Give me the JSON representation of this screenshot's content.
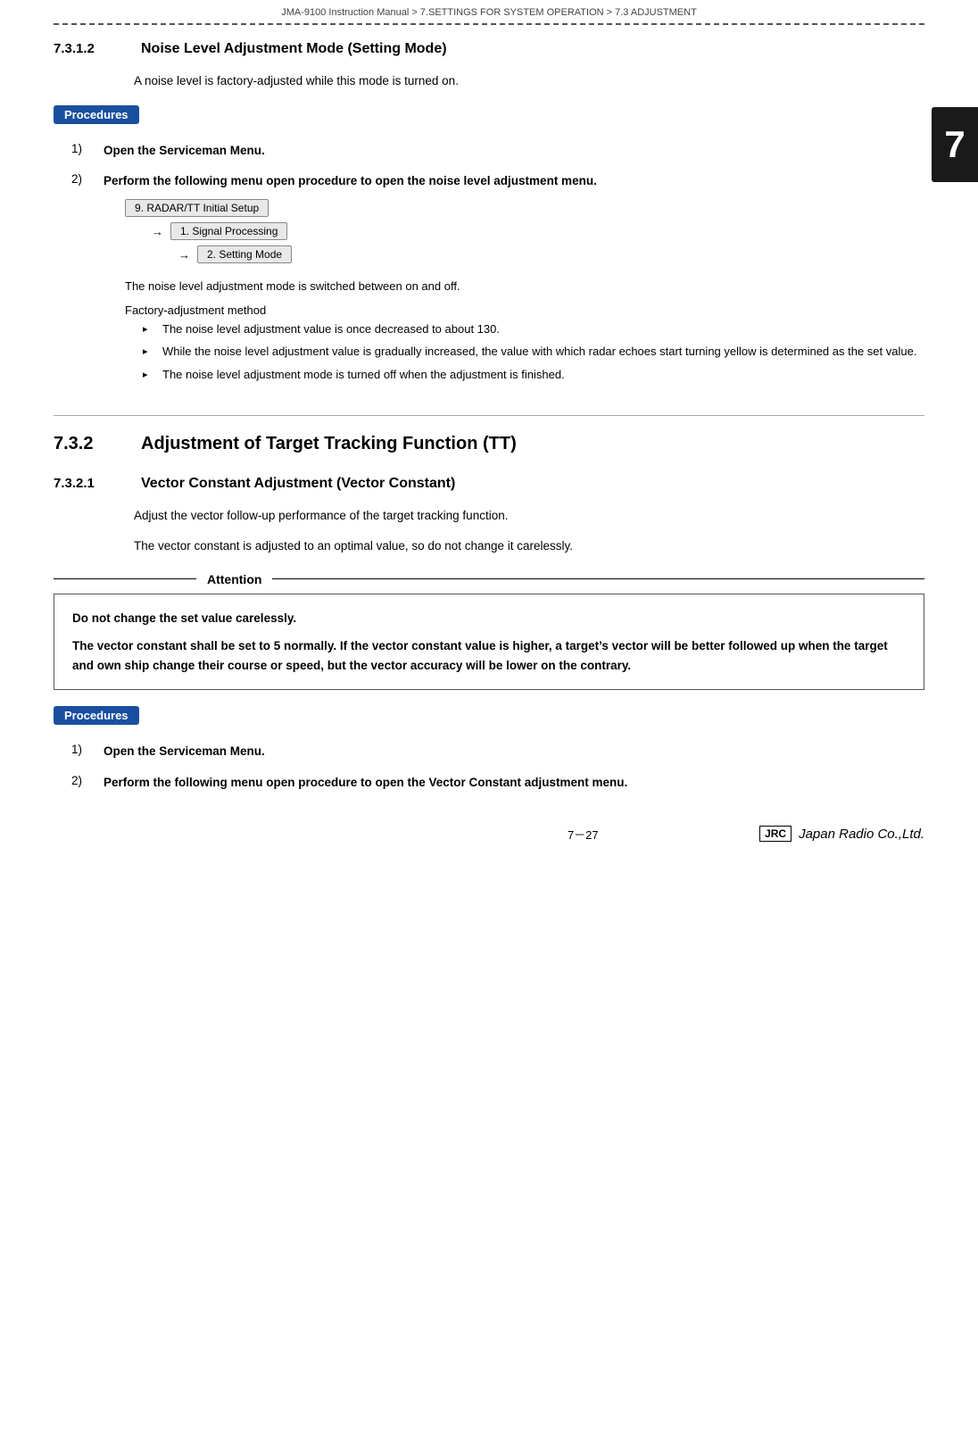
{
  "breadcrumb": "JMA-9100 Instruction Manual  >  7.SETTINGS FOR SYSTEM OPERATION  >  7.3  ADJUSTMENT",
  "section_7312": {
    "number": "7.3.1.2",
    "title": "Noise Level Adjustment Mode (Setting Mode)",
    "intro": "A noise level is factory-adjusted while this mode is turned on.",
    "procedures_label": "Procedures",
    "steps": [
      {
        "num": "1)",
        "text": "Open the Serviceman Menu."
      },
      {
        "num": "2)",
        "text": "Perform the following menu open procedure to open the noise level adjustment menu."
      }
    ],
    "menu_chain": [
      {
        "indent": 0,
        "arrow": false,
        "label": "9. RADAR/TT Initial Setup"
      },
      {
        "indent": 1,
        "arrow": true,
        "label": "1. Signal Processing"
      },
      {
        "indent": 2,
        "arrow": true,
        "label": "2. Setting Mode"
      }
    ],
    "sub_note": "The noise level adjustment mode is switched between on and off.",
    "factory_label": "Factory-adjustment method",
    "bullets": [
      "The noise level adjustment value is once decreased to about 130.",
      "While the noise level adjustment value is gradually increased, the value with which radar echoes start turning yellow is determined as the set value.",
      "The noise level adjustment mode is turned off when the adjustment is finished."
    ]
  },
  "section_732": {
    "number": "7.3.2",
    "title": "Adjustment of Target Tracking Function (TT)"
  },
  "section_7321": {
    "number": "7.3.2.1",
    "title": "Vector Constant Adjustment (Vector Constant)",
    "intro1": "Adjust the vector follow-up performance of the target tracking function.",
    "intro2": "The vector constant is adjusted to an optimal value, so do not change it carelessly.",
    "attention_label": "Attention",
    "attention_lines": [
      "Do not change the set value carelessly.",
      "The vector constant shall be set to 5 normally.  If the vector constant value is higher, a target’s vector will be better followed up when the target and own ship change their course or speed, but the vector accuracy will be lower on the contrary."
    ],
    "procedures_label": "Procedures",
    "steps": [
      {
        "num": "1)",
        "text": "Open the Serviceman Menu."
      },
      {
        "num": "2)",
        "text": "Perform the following menu open procedure to open the Vector Constant adjustment menu."
      }
    ]
  },
  "chapter_tab": "7",
  "footer": {
    "page": "7－27",
    "jrc_label": "JRC",
    "company": "Japan Radio Co.,Ltd."
  }
}
